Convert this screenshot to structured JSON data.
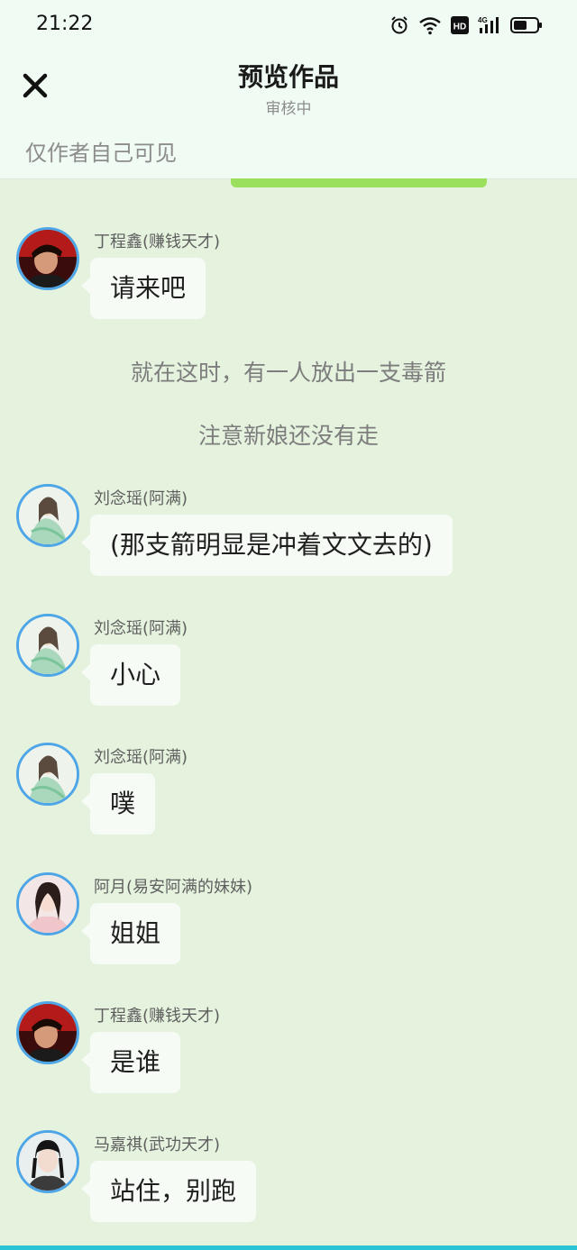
{
  "status_bar": {
    "time": "21:22"
  },
  "header": {
    "title": "预览作品",
    "subtitle": "审核中",
    "visibility_note": "仅作者自己可见",
    "close_icon": "close-icon"
  },
  "colors": {
    "accent_green": "#9be05c",
    "avatar_ring": "#4fa6e6",
    "background": "#e4f2de"
  },
  "messages": [
    {
      "type": "chat",
      "name": "丁程鑫(赚钱天才)",
      "text": "请来吧",
      "avatar": "avatar-dingchengxin"
    },
    {
      "type": "narration",
      "text": "就在这时，有一人放出一支毒箭"
    },
    {
      "type": "narration",
      "text": "注意新娘还没有走"
    },
    {
      "type": "chat",
      "name": "刘念瑶(阿满)",
      "text": "(那支箭明显是冲着文文去的)",
      "avatar": "avatar-liunianyao"
    },
    {
      "type": "chat",
      "name": "刘念瑶(阿满)",
      "text": "小心",
      "avatar": "avatar-liunianyao"
    },
    {
      "type": "chat",
      "name": "刘念瑶(阿满)",
      "text": "噗",
      "avatar": "avatar-liunianyao"
    },
    {
      "type": "chat",
      "name": "阿月(易安阿满的妹妹)",
      "text": "姐姐",
      "avatar": "avatar-ayue"
    },
    {
      "type": "chat",
      "name": "丁程鑫(赚钱天才)",
      "text": "是谁",
      "avatar": "avatar-dingchengxin"
    },
    {
      "type": "chat",
      "name": "马嘉祺(武功天才)",
      "text": "站住，别跑",
      "avatar": "avatar-majiaqi"
    }
  ]
}
